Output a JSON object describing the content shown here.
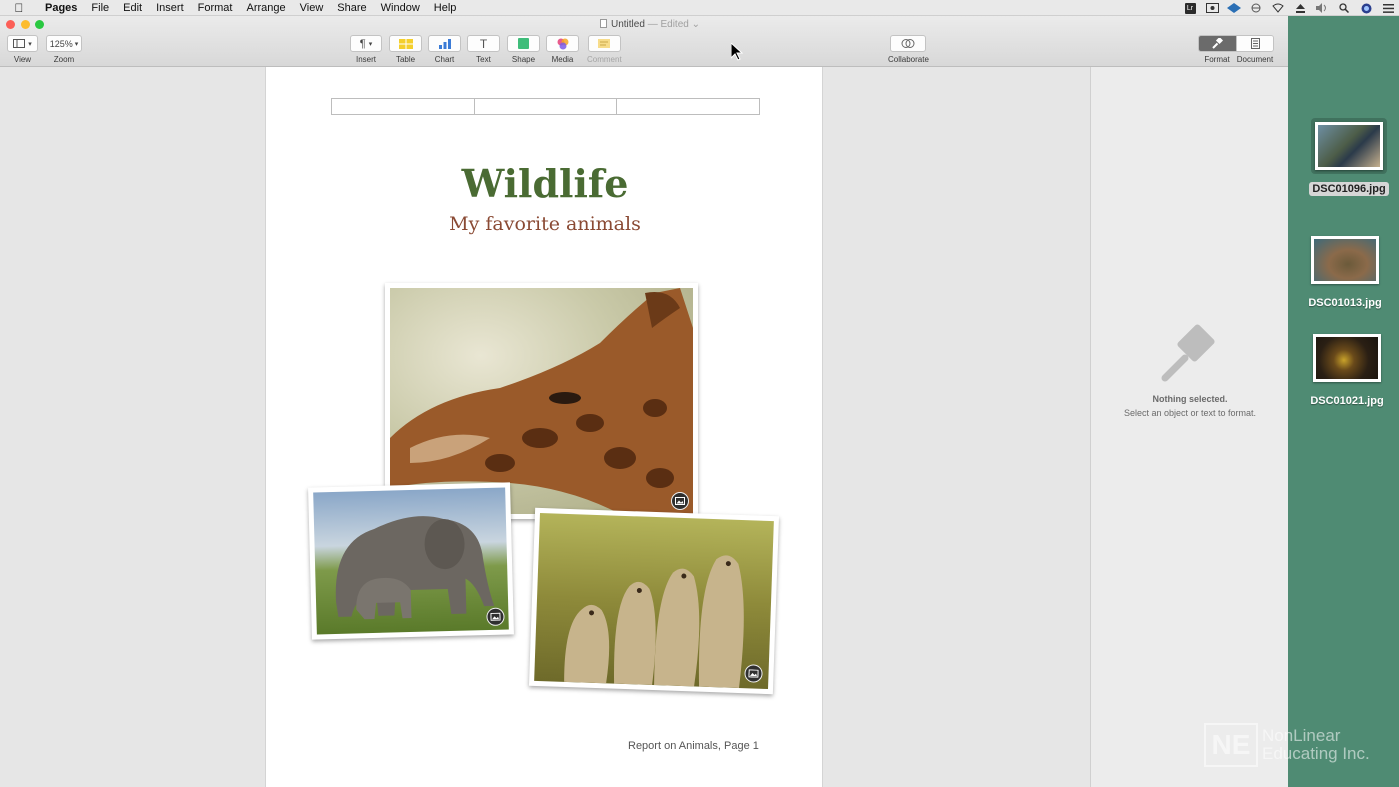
{
  "menubar": {
    "apple_icon": "apple-icon",
    "app_name": "Pages",
    "items": [
      "File",
      "Edit",
      "Insert",
      "Format",
      "Arrange",
      "View",
      "Share",
      "Window",
      "Help"
    ],
    "status_icons": [
      "lr-icon",
      "screen-record-icon",
      "network-sync-icon",
      "vpn-icon",
      "wifi-icon",
      "eject-icon",
      "volume-icon",
      "search-icon",
      "siri-icon",
      "list-icon"
    ]
  },
  "window": {
    "title": "Untitled",
    "edited": "— Edited"
  },
  "toolbar": {
    "view_label": "View",
    "zoom_value": "125%",
    "zoom_label": "Zoom",
    "insert_label": "Insert",
    "table_label": "Table",
    "chart_label": "Chart",
    "text_label": "Text",
    "shape_label": "Shape",
    "media_label": "Media",
    "comment_label": "Comment",
    "collaborate_label": "Collaborate",
    "format_label": "Format",
    "document_label": "Document"
  },
  "document": {
    "title": "Wildlife",
    "subtitle": "My favorite animals",
    "footer": "Report on Animals, Page 1",
    "title_color": "#4a6b33",
    "subtitle_color": "#8a4a34"
  },
  "inspector": {
    "title": "Nothing selected.",
    "subtitle": "Select an object or text to format."
  },
  "desktop": {
    "files": [
      {
        "name": "DSC01096.jpg",
        "selected": true
      },
      {
        "name": "DSC01013.jpg",
        "selected": false
      },
      {
        "name": "DSC01021.jpg",
        "selected": false
      }
    ],
    "background": "#4f8b73"
  },
  "watermark": {
    "logo": "NE",
    "line1": "NonLinear",
    "line2": "Educating Inc."
  }
}
